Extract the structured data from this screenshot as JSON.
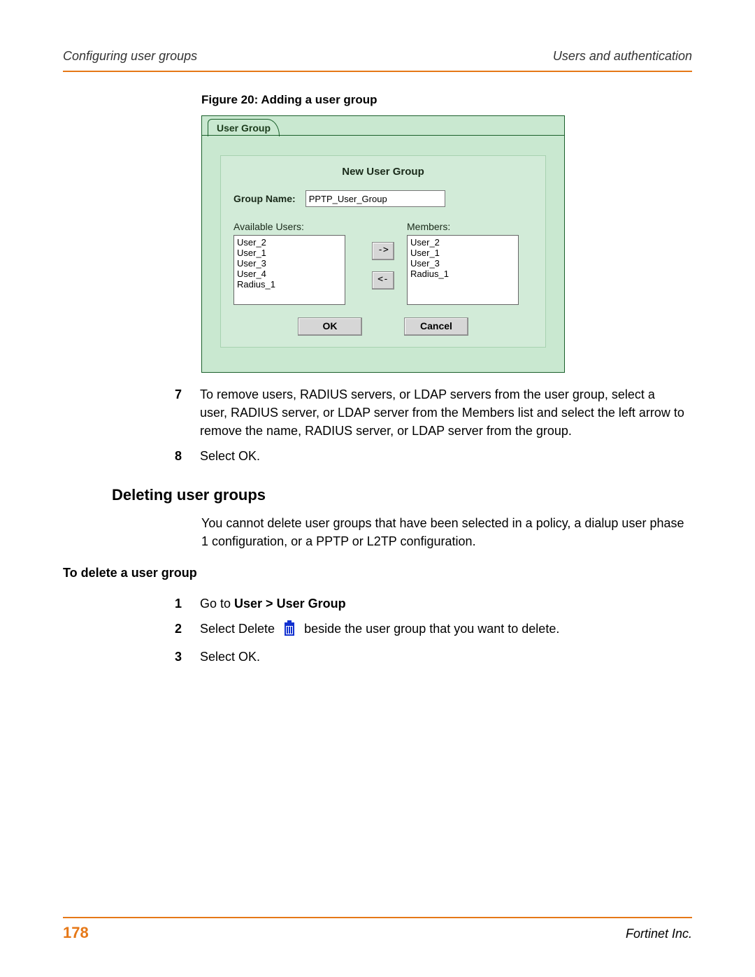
{
  "header": {
    "left": "Configuring user groups",
    "right": "Users and authentication"
  },
  "figure_caption": "Figure 20: Adding a user group",
  "dialog": {
    "tab_label": "User Group",
    "title": "New User Group",
    "group_name_label": "Group Name:",
    "group_name_value": "PPTP_User_Group",
    "available_label": "Available Users:",
    "members_label": "Members:",
    "available_list": "User_2\nUser_1\nUser_3\nUser_4\nRadius_1",
    "members_list": "User_2\nUser_1\nUser_3\nRadius_1",
    "add_arrow": "->",
    "remove_arrow": "<-",
    "ok_label": "OK",
    "cancel_label": "Cancel"
  },
  "steps_top": {
    "n7": "7",
    "t7": "To remove users, RADIUS servers, or LDAP servers from the user group, select a user, RADIUS server, or LDAP server from the Members list and select the left arrow to remove the name, RADIUS server, or LDAP server from the group.",
    "n8": "8",
    "t8": "Select OK."
  },
  "section_heading": "Deleting user groups",
  "section_intro": "You cannot delete user groups that have been selected in a policy, a dialup user phase 1 configuration, or a PPTP or L2TP configuration.",
  "delete_sub": "To delete a user group",
  "delete_steps": {
    "n1": "1",
    "t1_prefix": "Go to ",
    "t1_bold": "User > User Group",
    "n2": "2",
    "t2_before": "Select Delete ",
    "t2_after": " beside the user group that you want to delete.",
    "n3": "3",
    "t3": "Select OK."
  },
  "footer": {
    "page": "178",
    "company": "Fortinet Inc."
  }
}
